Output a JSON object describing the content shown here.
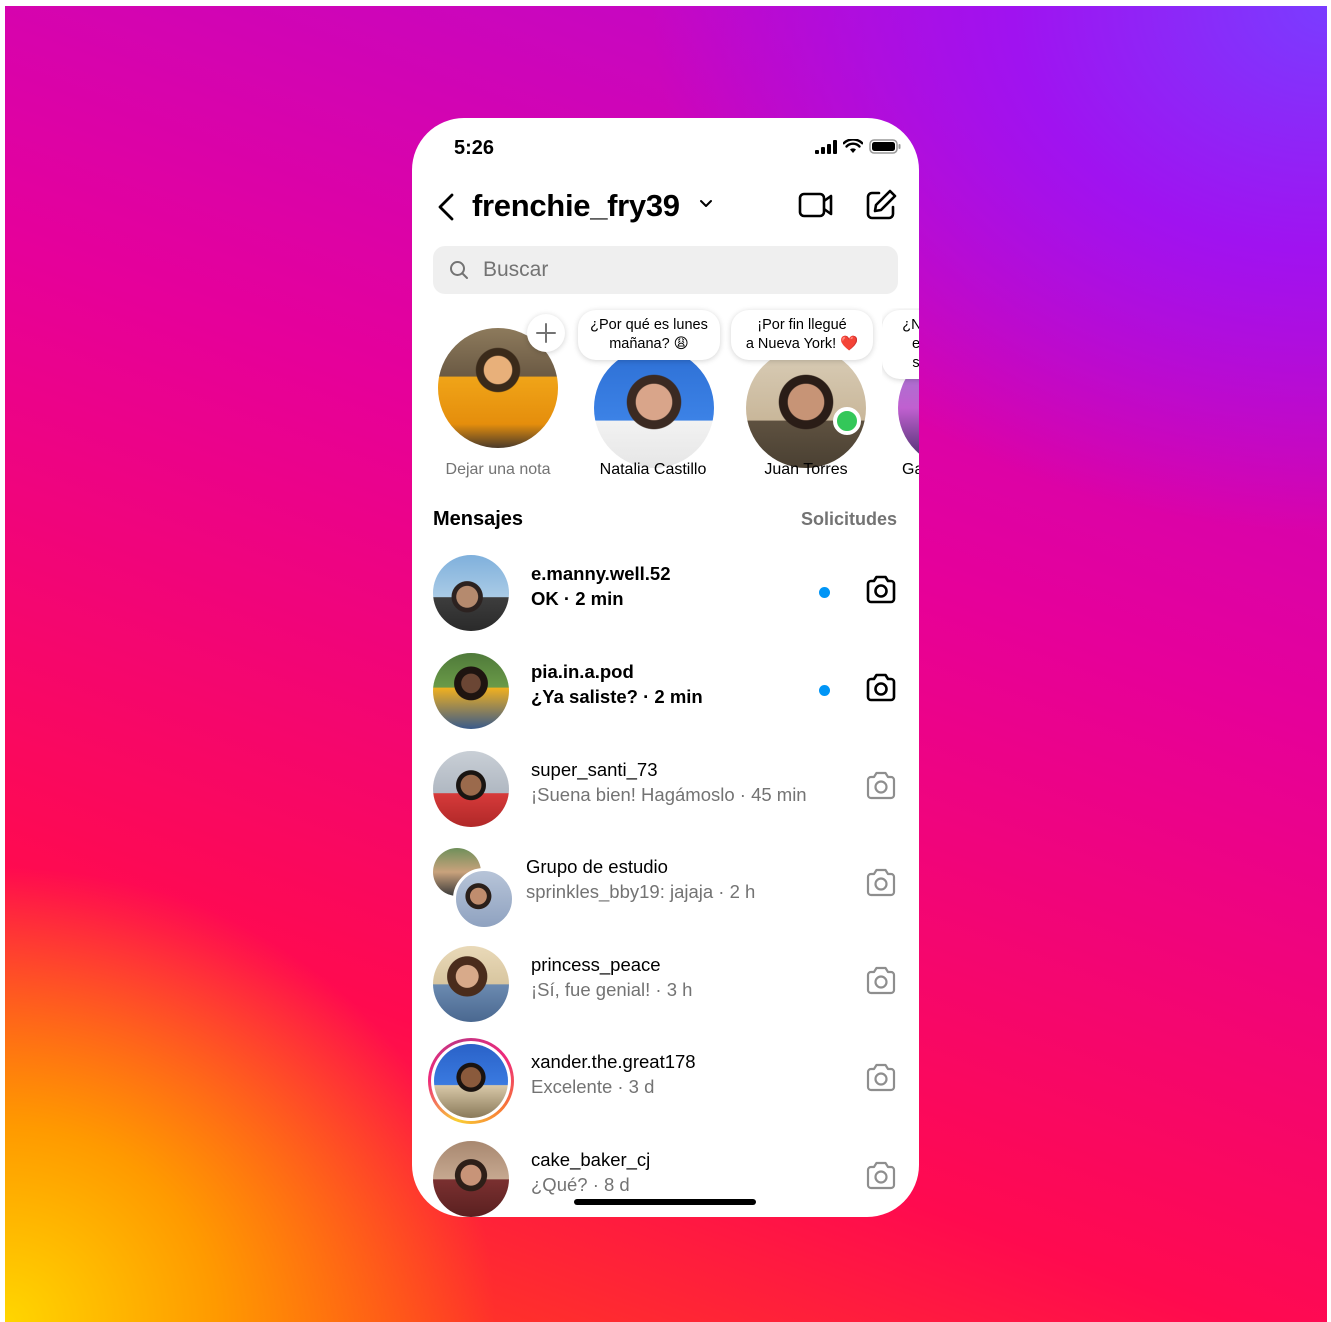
{
  "status": {
    "time": "5:26"
  },
  "header": {
    "username": "frenchie_fry39"
  },
  "search": {
    "placeholder": "Buscar"
  },
  "notes": [
    {
      "name": "Dejar una nota",
      "note": ""
    },
    {
      "name": "Natalia Castillo",
      "note_line1": "¿Por qué es lunes",
      "note_line2": "mañana? 😩"
    },
    {
      "name": "Juan Torres",
      "note_line1": "¡Por fin llegué",
      "note_line2": "a Nueva York! ❤️",
      "online": true
    },
    {
      "name": "Ga",
      "note_line1": "¿No",
      "note_line2": "e",
      "note_line3": "s"
    }
  ],
  "messages_section": {
    "title": "Mensajes",
    "requests_label": "Solicitudes"
  },
  "threads": [
    {
      "name": "e.manny.well.52",
      "preview": "OK · 2 min",
      "unread": true
    },
    {
      "name": "pia.in.a.pod",
      "preview": "¿Ya saliste?  · 2 min",
      "unread": true
    },
    {
      "name": "super_santi_73",
      "preview": "¡Suena bien! Hagámoslo · 45 min",
      "unread": false
    },
    {
      "name": "Grupo de estudio",
      "preview": "sprinkles_bby19: jajaja · 2 h",
      "unread": false
    },
    {
      "name": "princess_peace",
      "preview": "¡Sí, fue genial! · 3 h",
      "unread": false
    },
    {
      "name": "xander.the.great178",
      "preview": "Excelente · 3 d",
      "unread": false,
      "story_ring": true
    },
    {
      "name": "cake_baker_cj",
      "preview": "¿Qué? · 8 d",
      "unread": false
    }
  ],
  "colors": {
    "unread_dot": "#0095f6",
    "online": "#34c759",
    "muted_text": "#737373"
  }
}
